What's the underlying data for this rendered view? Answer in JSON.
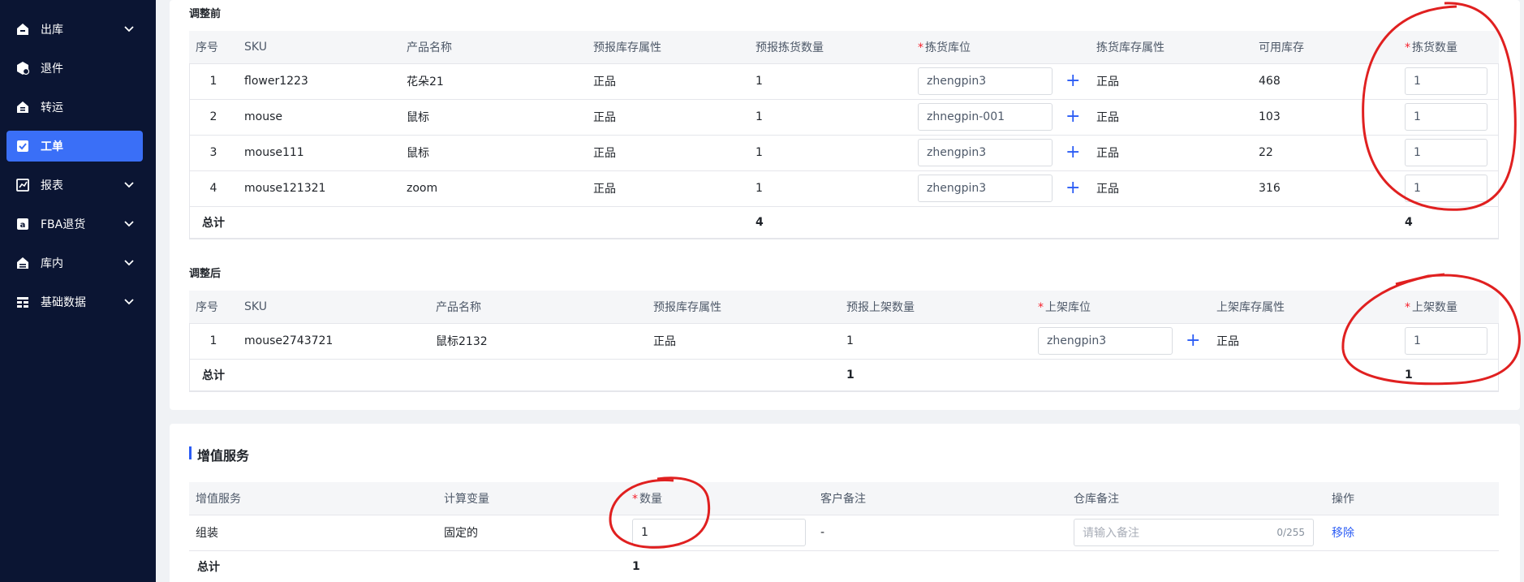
{
  "sidebar": {
    "items": [
      {
        "label": "出库",
        "icon": "outbound-icon",
        "has_chevron": true,
        "active": false
      },
      {
        "label": "退件",
        "icon": "return-icon",
        "has_chevron": false,
        "active": false
      },
      {
        "label": "转运",
        "icon": "transfer-icon",
        "has_chevron": false,
        "active": false
      },
      {
        "label": "工单",
        "icon": "workorder-icon",
        "has_chevron": false,
        "active": true
      },
      {
        "label": "报表",
        "icon": "report-icon",
        "has_chevron": true,
        "active": false
      },
      {
        "label": "FBA退货",
        "icon": "fba-return-icon",
        "has_chevron": true,
        "active": false
      },
      {
        "label": "库内",
        "icon": "warehouse-icon",
        "has_chevron": true,
        "active": false
      },
      {
        "label": "基础数据",
        "icon": "base-data-icon",
        "has_chevron": true,
        "active": false
      }
    ]
  },
  "before": {
    "title": "调整前",
    "headers": {
      "index": "序号",
      "sku": "SKU",
      "name": "产品名称",
      "attr": "预报库存属性",
      "qty": "预报拣货数量",
      "location": "拣货库位",
      "loc_attr": "拣货库存属性",
      "avail": "可用库存",
      "pick_qty": "拣货数量"
    },
    "rows": [
      {
        "index": "1",
        "sku": "flower1223",
        "name": "花朵21",
        "attr": "正品",
        "qty": "1",
        "location": "zhengpin3",
        "loc_attr": "正品",
        "avail": "468",
        "pick_qty": "1"
      },
      {
        "index": "2",
        "sku": "mouse",
        "name": "鼠标",
        "attr": "正品",
        "qty": "1",
        "location": "zhnegpin-001",
        "loc_attr": "正品",
        "avail": "103",
        "pick_qty": "1"
      },
      {
        "index": "3",
        "sku": "mouse111",
        "name": "鼠标",
        "attr": "正品",
        "qty": "1",
        "location": "zhengpin3",
        "loc_attr": "正品",
        "avail": "22",
        "pick_qty": "1"
      },
      {
        "index": "4",
        "sku": "mouse121321",
        "name": "zoom",
        "attr": "正品",
        "qty": "1",
        "location": "zhengpin3",
        "loc_attr": "正品",
        "avail": "316",
        "pick_qty": "1"
      }
    ],
    "total": {
      "label": "总计",
      "qty": "4",
      "pick_qty": "4"
    }
  },
  "after": {
    "title": "调整后",
    "headers": {
      "index": "序号",
      "sku": "SKU",
      "name": "产品名称",
      "attr": "预报库存属性",
      "qty": "预报上架数量",
      "location": "上架库位",
      "loc_attr": "上架库存属性",
      "put_qty": "上架数量"
    },
    "rows": [
      {
        "index": "1",
        "sku": "mouse2743721",
        "name": "鼠标2132",
        "attr": "正品",
        "qty": "1",
        "location": "zhengpin3",
        "loc_attr": "正品",
        "put_qty": "1"
      }
    ],
    "total": {
      "label": "总计",
      "qty": "1",
      "put_qty": "1"
    }
  },
  "vas": {
    "title": "增值服务",
    "headers": {
      "service": "增值服务",
      "variable": "计算变量",
      "qty": "数量",
      "customer_note": "客户备注",
      "warehouse_note": "仓库备注",
      "action": "操作"
    },
    "rows": [
      {
        "service": "组装",
        "variable": "固定的",
        "qty": "1",
        "customer_note": "-",
        "warehouse_note_placeholder": "请输入备注",
        "char_count": "0/255",
        "action": "移除"
      }
    ],
    "total": {
      "label": "总计",
      "qty": "1"
    }
  },
  "colors": {
    "sidebar_bg": "#0b1533",
    "active": "#3a6ff7",
    "link": "#2b5cf5",
    "required": "#f5222d",
    "annotation": "#e02020"
  }
}
